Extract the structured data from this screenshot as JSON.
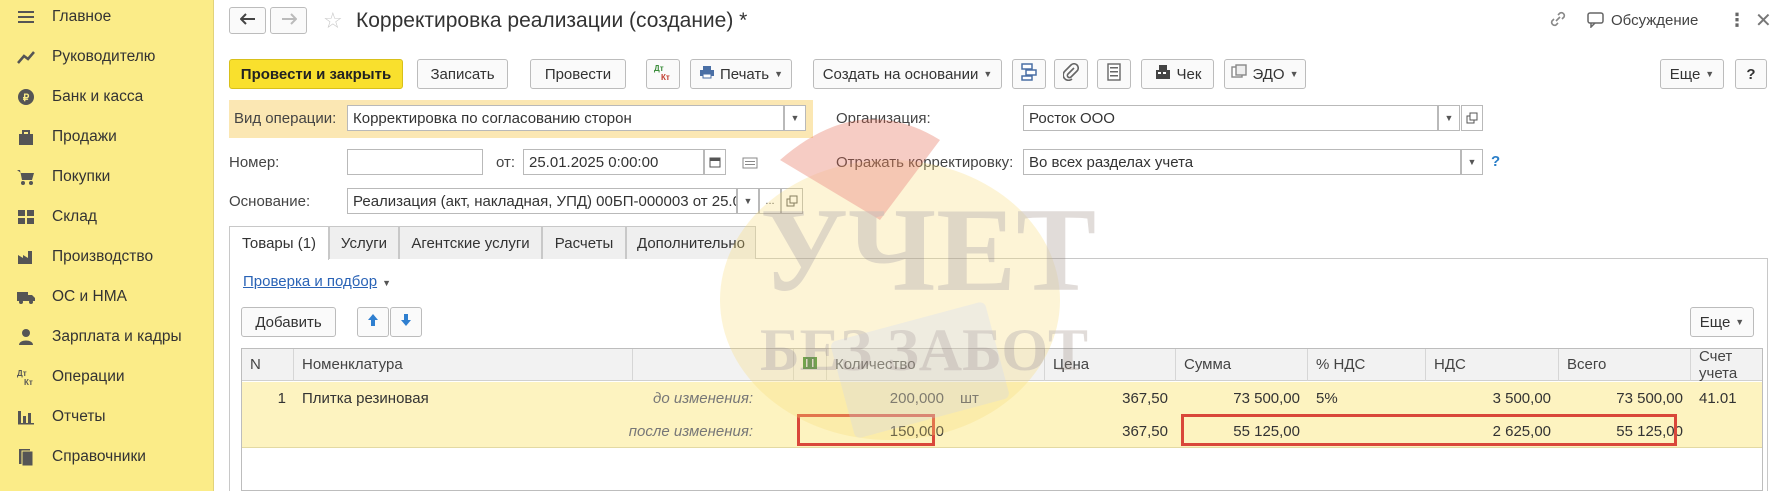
{
  "sidebar": {
    "items": [
      {
        "label": "Главное",
        "icon": "menu-icon"
      },
      {
        "label": "Руководителю",
        "icon": "trend-icon"
      },
      {
        "label": "Банк и касса",
        "icon": "coin-icon"
      },
      {
        "label": "Продажи",
        "icon": "bag-icon"
      },
      {
        "label": "Покупки",
        "icon": "cart-icon"
      },
      {
        "label": "Склад",
        "icon": "warehouse-icon"
      },
      {
        "label": "Производство",
        "icon": "factory-icon"
      },
      {
        "label": "ОС и НМА",
        "icon": "truck-icon"
      },
      {
        "label": "Зарплата и кадры",
        "icon": "person-icon"
      },
      {
        "label": "Операции",
        "icon": "dt-kt-icon"
      },
      {
        "label": "Отчеты",
        "icon": "bar-chart-icon"
      },
      {
        "label": "Справочники",
        "icon": "books-icon"
      }
    ]
  },
  "header": {
    "title": "Корректировка реализации (создание) *",
    "discussion": "Обсуждение"
  },
  "toolbar": {
    "post_close": "Провести и закрыть",
    "save": "Записать",
    "post": "Провести",
    "dtkt": "Дт Кт",
    "print": "Печать",
    "create_based": "Создать на основании",
    "check": "Чек",
    "edo": "ЭДО",
    "more": "Еще",
    "help": "?"
  },
  "form": {
    "op_type_label": "Вид операции:",
    "op_type_value": "Корректировка по согласованию сторон",
    "org_label": "Организация:",
    "org_value": "Росток ООО",
    "number_label": "Номер:",
    "number_value": "",
    "date_label": "от:",
    "date_value": "25.01.2025  0:00:00",
    "reflect_label": "Отражать корректировку:",
    "reflect_value": "Во всех разделах учета",
    "reflect_help": "?",
    "basis_label": "Основание:",
    "basis_value": "Реализация (акт, накладная, УПД) 00БП-000003 от 25.0"
  },
  "tabs": [
    "Товары (1)",
    "Услуги",
    "Агентские услуги",
    "Расчеты",
    "Дополнительно"
  ],
  "goods": {
    "check_link": "Проверка и подбор",
    "add": "Добавить",
    "more": "Еще"
  },
  "table": {
    "headers": {
      "n": "N",
      "nom": "Номенклатура",
      "qty": "Количество",
      "price": "Цена",
      "sum": "Сумма",
      "vat_rate": "% НДС",
      "vat": "НДС",
      "total": "Всего",
      "account": "Счет учета"
    },
    "row": {
      "n": "1",
      "name": "Плитка резиновая",
      "before_label": "до изменения:",
      "after_label": "после изменения:",
      "before": {
        "qty": "200,000",
        "unit": "шт",
        "price": "367,50",
        "sum": "73 500,00",
        "vat_rate": "5%",
        "vat": "3 500,00",
        "total": "73 500,00",
        "account": "41.01"
      },
      "after": {
        "qty": "150,000",
        "price": "367,50",
        "sum": "55 125,00",
        "vat": "2 625,00",
        "total": "55 125,00"
      }
    }
  },
  "watermark": {
    "line1": "УЧЕТ",
    "line2": "БЕЗ ЗАБОТ"
  },
  "colors": {
    "sidebar": "#fbec88",
    "primary_button": "#f9e02d",
    "highlight": "#d9473a",
    "row": "#fdf3c0"
  }
}
